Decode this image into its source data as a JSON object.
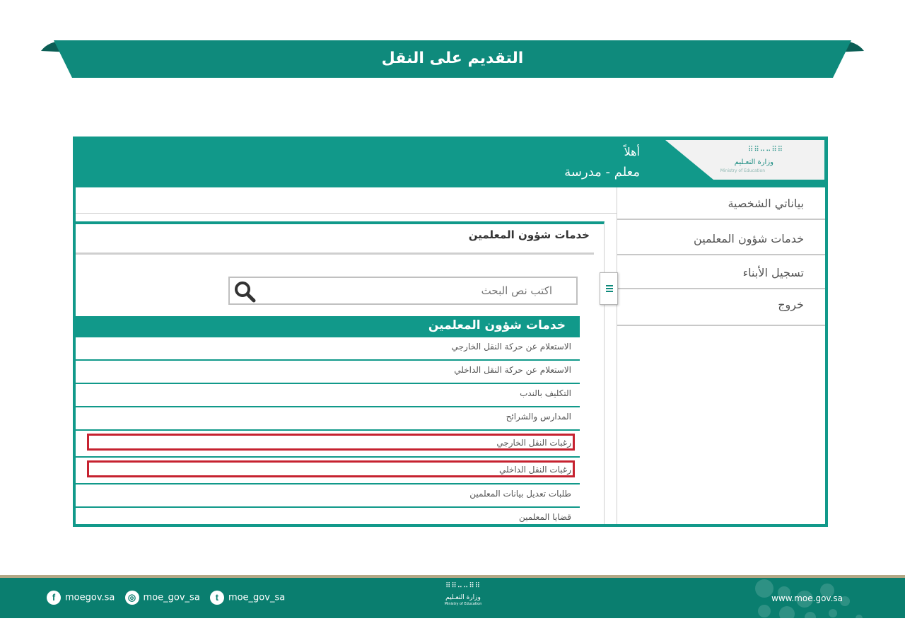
{
  "page": {
    "title": "التقديم على النقل"
  },
  "header": {
    "logo": {
      "name": "وزارة التعـليم",
      "name_en": "Ministry of Education"
    },
    "greeting": "أهلاً",
    "user_role": "معلم - مدرسة"
  },
  "sidebar": {
    "items": [
      {
        "label": "بياناتي الشخصية"
      },
      {
        "label": "خدمات شؤون المعلمين"
      },
      {
        "label": "تسجيل الأبناء"
      },
      {
        "label": "خروج"
      }
    ]
  },
  "panel": {
    "title": "خدمات شؤون المعلمين",
    "search": {
      "placeholder": "اكتب نص البحث"
    },
    "services_heading": "خدمات شؤون المعلمين",
    "services": [
      {
        "label": "الاستعلام عن حركة النقل الخارجي",
        "highlighted": false
      },
      {
        "label": "الاستعلام عن حركة النقل الداخلي",
        "highlighted": false
      },
      {
        "label": "التكليف بالندب",
        "highlighted": false
      },
      {
        "label": "المدارس والشرائح",
        "highlighted": false
      },
      {
        "label": "رغبات النقل الخارجي",
        "highlighted": true
      },
      {
        "label": "رغبات النقل الداخلي",
        "highlighted": true
      },
      {
        "label": "طلبات تعديل بيانات المعلمين",
        "highlighted": false
      },
      {
        "label": "قضايا المعلمين",
        "highlighted": false
      }
    ]
  },
  "footer": {
    "social": [
      {
        "icon": "facebook-icon",
        "handle": "moegov.sa"
      },
      {
        "icon": "instagram-icon",
        "handle": "moe_gov_sa"
      },
      {
        "icon": "twitter-icon",
        "handle": "moe_gov_sa"
      }
    ],
    "logo": {
      "name": "وزارة التعـليم",
      "name_en": "Ministry of Education"
    },
    "website": "www.moe.gov.sa"
  },
  "colors": {
    "primary": "#11998a",
    "highlight": "#c62230",
    "footer": "#0a7e6f"
  }
}
